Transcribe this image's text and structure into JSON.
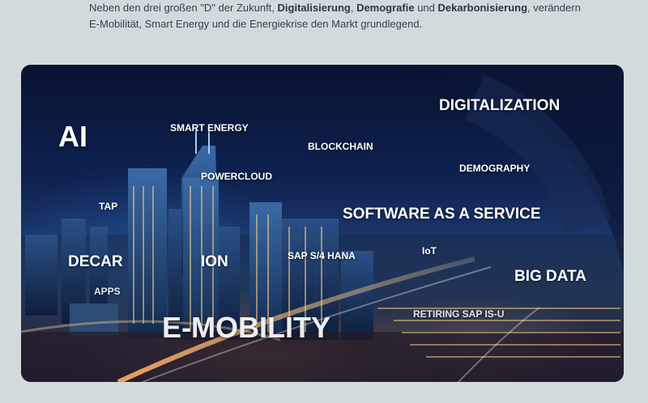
{
  "intro": {
    "p1": "Neben den drei großen \"D\" der Zukunft, ",
    "b1": "Digitalisierung",
    "p2": ", ",
    "b2": "Demografie",
    "p3": " und ",
    "b3": "Dekarbonisierung",
    "p4": ", verändern",
    "line2": "E-Mobilität, Smart Energy und die Energiekrise den Markt grundlegend."
  },
  "hero": {
    "keywords": {
      "ai": "AI",
      "smart_energy": "SMART ENERGY",
      "blockchain": "BLOCKCHAIN",
      "digitalization": "DIGITALIZATION",
      "demography": "DEMOGRAPHY",
      "powercloud": "POWERCLOUD",
      "tap": "TAP",
      "software_as_a_service": "SOFTWARE AS A SERVICE",
      "decar": "DECAR",
      "ion": "ION",
      "sap_s4_hana": "SAP S/4 HANA",
      "iot": "IoT",
      "apps": "APPS",
      "big_data": "BIG DATA",
      "retiring_sap_is_u": "RETIRING SAP IS-U",
      "e_mobility": "E-MOBILITY"
    }
  }
}
